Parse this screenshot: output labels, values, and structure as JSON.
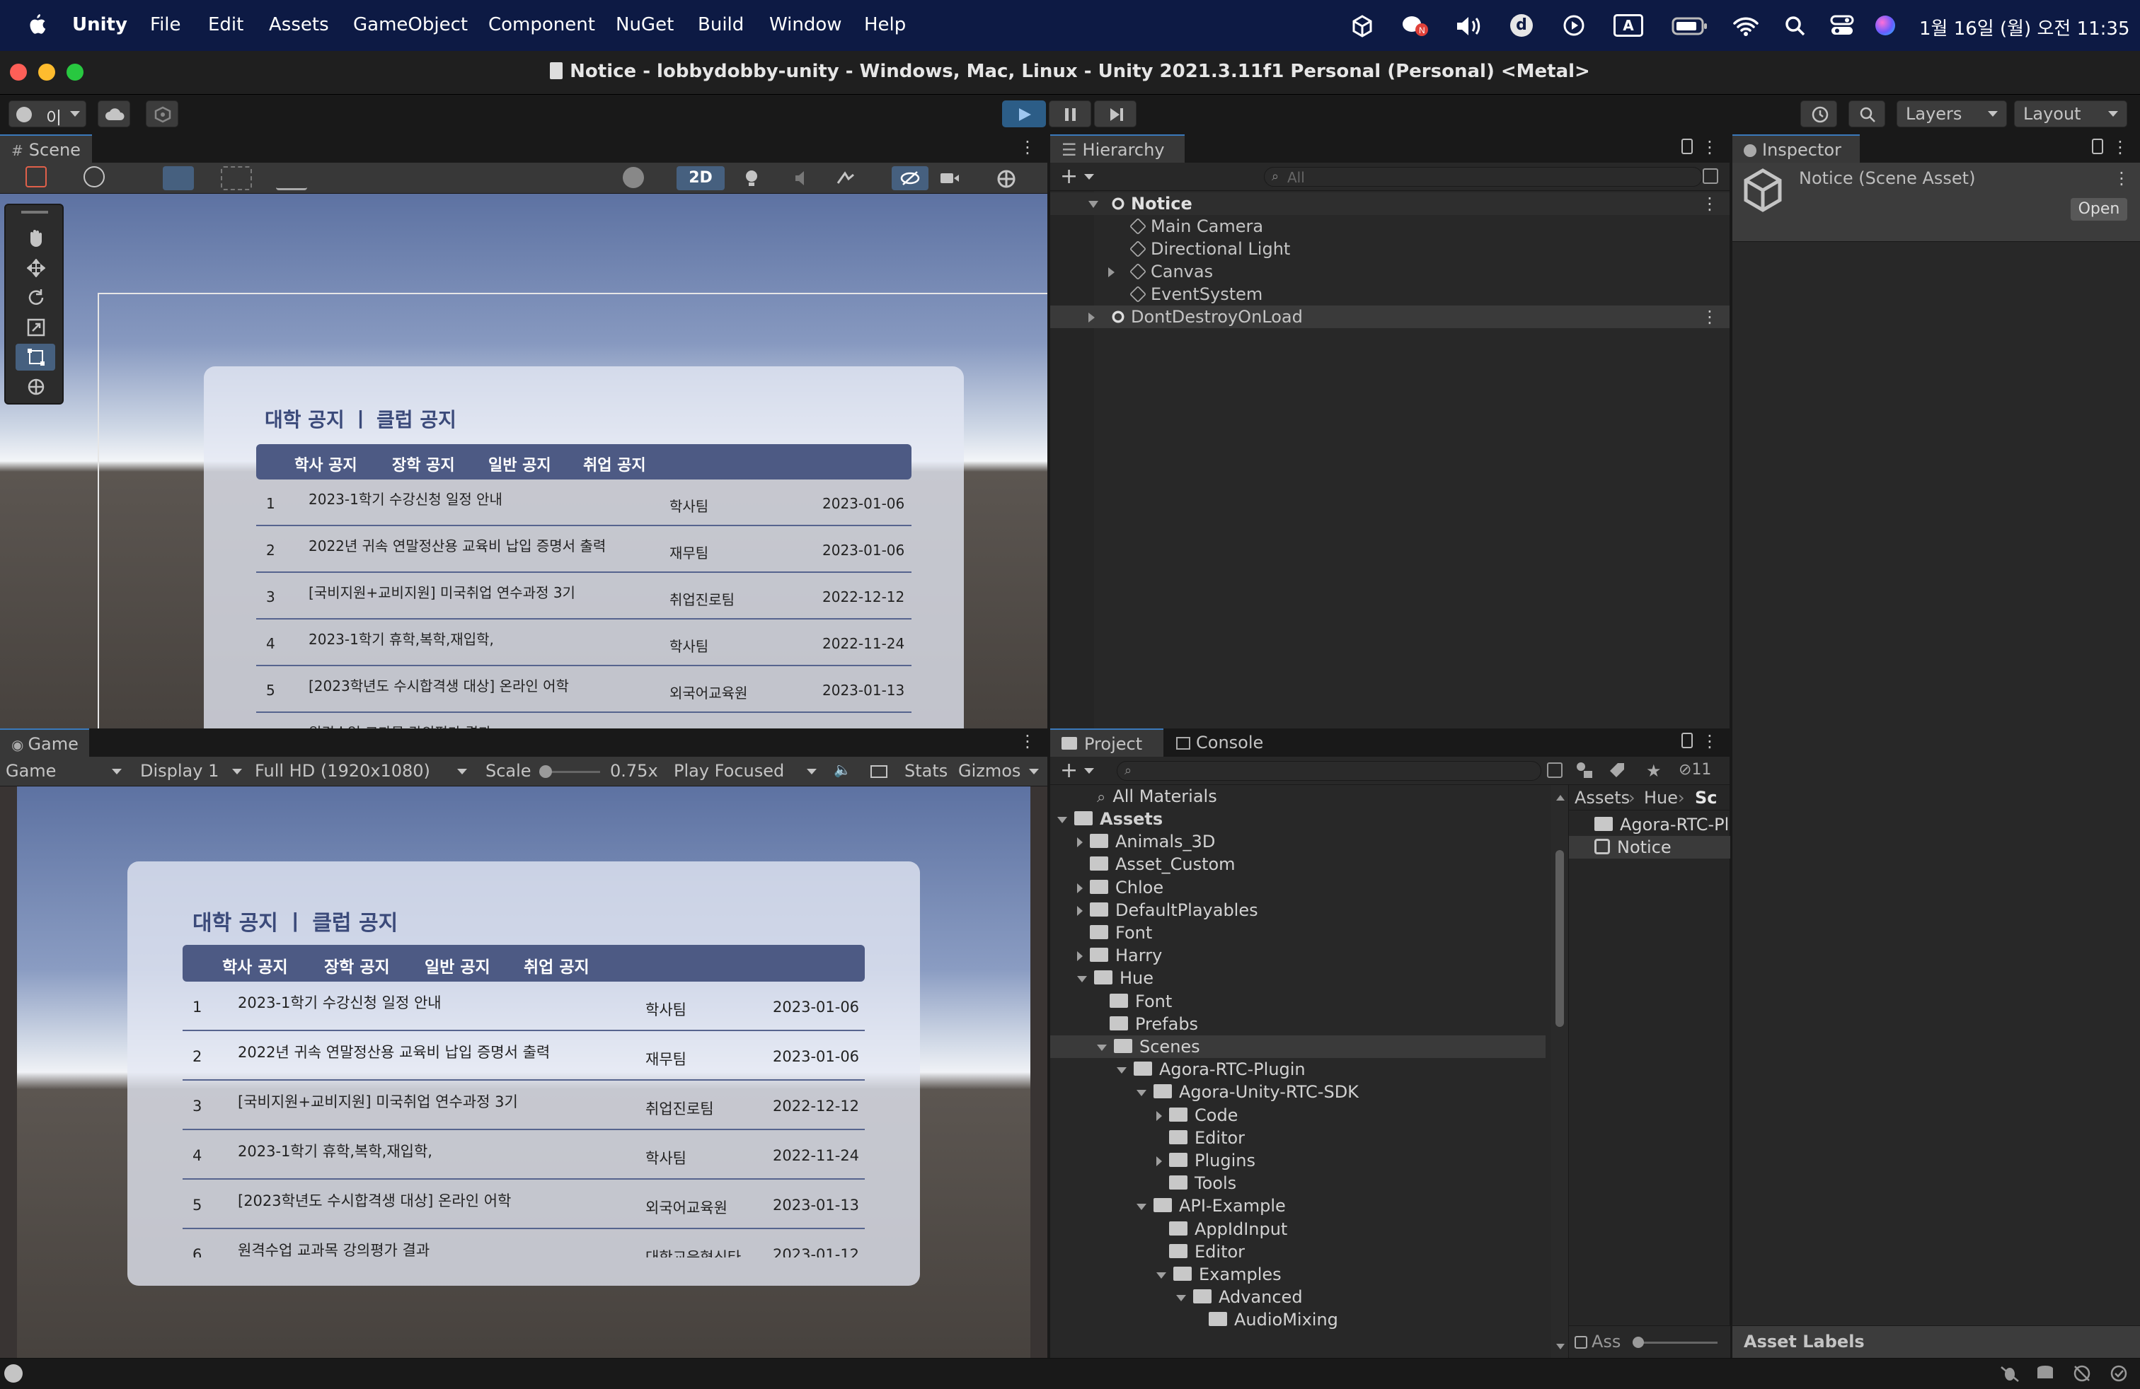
{
  "menubar": {
    "apple": "",
    "app": "Unity",
    "items": [
      "File",
      "Edit",
      "Assets",
      "GameObject",
      "Component",
      "NuGet",
      "Build",
      "Window",
      "Help"
    ],
    "input_indicator": "A",
    "clock": "1월 16일 (월) 오전 11:35",
    "status_icons": [
      "unity-icon",
      "wechat-icon",
      "volume-icon",
      "d-icon",
      "play-circle-icon",
      "input-icon",
      "battery-icon",
      "wifi-icon",
      "search-icon",
      "control-center-icon",
      "siri-icon"
    ]
  },
  "window": {
    "title": "Notice - lobbydobby-unity - Windows, Mac, Linux - Unity 2021.3.11f1 Personal (Personal) <Metal>"
  },
  "toolbar": {
    "account": "이",
    "layers": "Layers",
    "layout": "Layout"
  },
  "scene": {
    "tab": "Scene",
    "toggle_2d": "2D"
  },
  "game": {
    "tab": "Game",
    "mode": "Game",
    "display": "Display 1",
    "resolution": "Full HD (1920x1080)",
    "scale_label": "Scale",
    "scale_value": "0.75x",
    "play_focused": "Play Focused",
    "stats": "Stats",
    "gizmos": "Gizmos"
  },
  "notice": {
    "title": "대학 공지 ㅣ 클럽 공지",
    "tabs": [
      "학사 공지",
      "장학 공지",
      "일반 공지",
      "취업 공지"
    ],
    "rows": [
      {
        "no": "1",
        "title": "2023-1학기 수강신청 일정 안내",
        "dept": "학사팀",
        "date": "2023-01-06"
      },
      {
        "no": "2",
        "title": "2022년 귀속 연말정산용 교육비 납입 증명서 출력",
        "dept": "재무팀",
        "date": "2023-01-06"
      },
      {
        "no": "3",
        "title": "[국비지원+교비지원] 미국취업 연수과정 3기",
        "dept": "취업진로팀",
        "date": "2022-12-12"
      },
      {
        "no": "4",
        "title": "2023-1학기 휴학,복학,재입학,",
        "dept": "학사팀",
        "date": "2022-11-24"
      },
      {
        "no": "5",
        "title": "[2023학년도 수시합격생 대상] 온라인 어학",
        "dept": "외국어교육원",
        "date": "2023-01-13"
      },
      {
        "no": "6",
        "title": "원격수업 교과목 강의평가 결과",
        "dept": "대학교육혁신타",
        "date": "2023-01-12"
      }
    ],
    "scene_row6_partial": "원격수업 교과목 강의평가 결과"
  },
  "hierarchy": {
    "tab": "Hierarchy",
    "search_placeholder": "All",
    "items": [
      {
        "label": "Notice",
        "level": 0,
        "kind": "scene",
        "bold": true
      },
      {
        "label": "Main Camera",
        "level": 1,
        "kind": "object"
      },
      {
        "label": "Directional Light",
        "level": 1,
        "kind": "object"
      },
      {
        "label": "Canvas",
        "level": 1,
        "kind": "object",
        "collapsed": true
      },
      {
        "label": "EventSystem",
        "level": 1,
        "kind": "object"
      },
      {
        "label": "DontDestroyOnLoad",
        "level": 0,
        "kind": "scene",
        "collapsed": true
      }
    ]
  },
  "inspector": {
    "tab": "Inspector",
    "asset": "Notice (Scene Asset)",
    "open": "Open",
    "labels": "Asset Labels"
  },
  "project": {
    "tabs": [
      "Project",
      "Console"
    ],
    "hidden_count": "11",
    "favorites": "All Materials",
    "tree": [
      {
        "label": "Assets",
        "level": 0,
        "open": true,
        "bold": true
      },
      {
        "label": "Animals_3D",
        "level": 1,
        "arrow": "closed"
      },
      {
        "label": "Asset_Custom",
        "level": 1,
        "arrow": "none"
      },
      {
        "label": "Chloe",
        "level": 1,
        "arrow": "closed"
      },
      {
        "label": "DefaultPlayables",
        "level": 1,
        "arrow": "closed"
      },
      {
        "label": "Font",
        "level": 1,
        "arrow": "none"
      },
      {
        "label": "Harry",
        "level": 1,
        "arrow": "closed"
      },
      {
        "label": "Hue",
        "level": 1,
        "arrow": "open"
      },
      {
        "label": "Font",
        "level": 2,
        "arrow": "none"
      },
      {
        "label": "Prefabs",
        "level": 2,
        "arrow": "none"
      },
      {
        "label": "Scenes",
        "level": 2,
        "arrow": "open",
        "selected": true
      },
      {
        "label": "Agora-RTC-Plugin",
        "level": 3,
        "arrow": "open"
      },
      {
        "label": "Agora-Unity-RTC-SDK",
        "level": 4,
        "arrow": "open"
      },
      {
        "label": "Code",
        "level": 5,
        "arrow": "closed"
      },
      {
        "label": "Editor",
        "level": 5,
        "arrow": "none"
      },
      {
        "label": "Plugins",
        "level": 5,
        "arrow": "closed"
      },
      {
        "label": "Tools",
        "level": 5,
        "arrow": "none"
      },
      {
        "label": "API-Example",
        "level": 4,
        "arrow": "open"
      },
      {
        "label": "AppIdInput",
        "level": 5,
        "arrow": "none"
      },
      {
        "label": "Editor",
        "level": 5,
        "arrow": "none"
      },
      {
        "label": "Examples",
        "level": 5,
        "arrow": "open"
      },
      {
        "label": "Advanced",
        "level": 6,
        "arrow": "open"
      },
      {
        "label": "AudioMixing",
        "level": 7,
        "arrow": "none"
      }
    ],
    "breadcrumb": [
      "Assets",
      "Hue",
      "Sc"
    ],
    "files": [
      {
        "label": "Agora-RTC-Pl",
        "kind": "folder"
      },
      {
        "label": "Notice",
        "kind": "scene",
        "selected": true
      }
    ],
    "zoom_label": "Ass"
  }
}
